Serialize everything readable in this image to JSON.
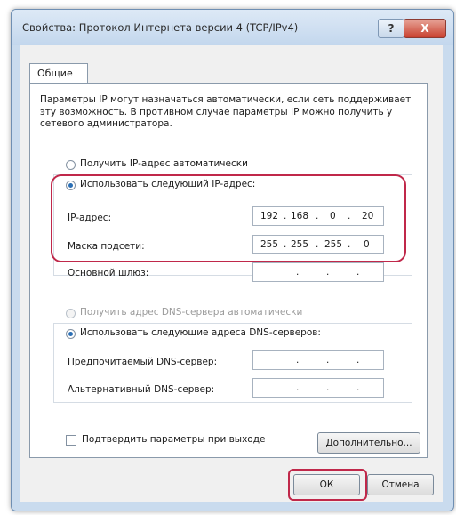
{
  "window": {
    "title": "Свойства: Протокол Интернета версии 4 (TCP/IPv4)",
    "help_label": "?",
    "close_label": "X"
  },
  "tab": {
    "label": "Общие"
  },
  "description": "Параметры IP могут назначаться автоматически, если сеть поддерживает эту возможность. В противном случае параметры IP можно получить у сетевого администратора.",
  "ip_section": {
    "auto_label": "Получить IP-адрес автоматически",
    "manual_label": "Использовать следующий IP-адрес:",
    "selected": "manual",
    "fields": [
      {
        "label": "IP-адрес:",
        "octets": [
          "192",
          "168",
          "0",
          "20"
        ]
      },
      {
        "label": "Маска подсети:",
        "octets": [
          "255",
          "255",
          "255",
          "0"
        ]
      },
      {
        "label": "Основной шлюз:",
        "octets": [
          "",
          "",
          "",
          ""
        ]
      }
    ]
  },
  "dns_section": {
    "auto_label": "Получить адрес DNS-сервера автоматически",
    "manual_label": "Использовать следующие адреса DNS-серверов:",
    "selected": "manual",
    "fields": [
      {
        "label": "Предпочитаемый DNS-сервер:",
        "octets": [
          "",
          "",
          "",
          ""
        ]
      },
      {
        "label": "Альтернативный DNS-сервер:",
        "octets": [
          "",
          "",
          "",
          ""
        ]
      }
    ]
  },
  "validate_label": "Подтвердить параметры при выходе",
  "advanced_label": "Дополнительно...",
  "ok_label": "ОК",
  "cancel_label": "Отмена",
  "colors": {
    "highlight": "#c0284a",
    "frame": "#c9dbee"
  }
}
